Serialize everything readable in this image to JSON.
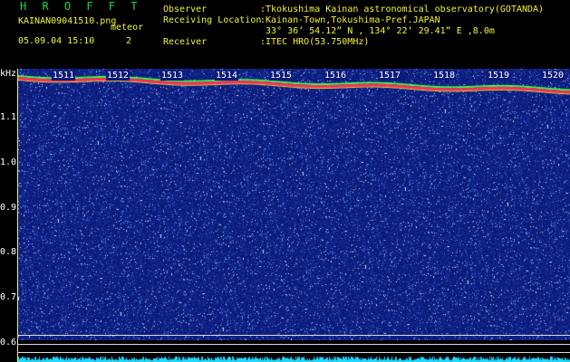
{
  "header": {
    "title": "H R O F F T",
    "filename": "KAINAN09041510.png",
    "meteor_label": "meteor",
    "date_time": "05.09.04 15:10",
    "meteor_count": "2",
    "observer_label": "Observer",
    "observer_value": ":Tkokushima Kainan astronomical observatory(GOTANDA)",
    "location_label": "Receiving Location",
    "location_value": ":Kainan-Town,Tokushima-Pref.JAPAN",
    "coords_value": "33° 36’ 54.12” N , 134° 22’ 29.41” E ,8.0m",
    "receiver_label": "Receiver",
    "receiver_value": ":ITEC HRO(53.750MHz)"
  },
  "axis": {
    "unit": "kHz",
    "y_labels": [
      "1.1",
      "1.0",
      "0.9",
      "0.8",
      "0.7",
      "0.6"
    ],
    "x_labels": [
      "1511",
      "1512",
      "1513",
      "1514",
      "1515",
      "1516",
      "1517",
      "1518",
      "1519",
      "1520"
    ]
  },
  "colors": {
    "background": "#0b1a78",
    "title_green": "#23d44a",
    "info_yellow": "#f2f23a",
    "text_white": "#ffffff",
    "carrier_red": "#ff2a55",
    "carrier_green": "#3cff4a",
    "noise_cyan": "#22d7ff"
  }
}
